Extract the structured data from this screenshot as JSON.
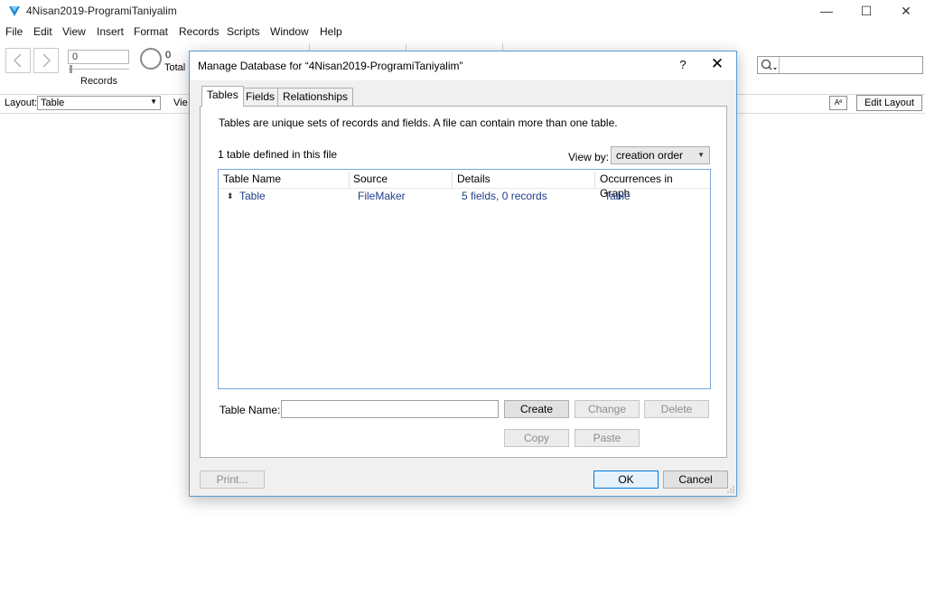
{
  "window": {
    "title": "4Nisan2019-ProgramiTaniyalim",
    "controls": {
      "minimize": "—",
      "maximize": "☐",
      "close": "✕"
    }
  },
  "menu": [
    "File",
    "Edit",
    "View",
    "Insert",
    "Format",
    "Records",
    "Scripts",
    "Window",
    "Help"
  ],
  "toolbar": {
    "record_value": "0",
    "records_label": "Records",
    "total_count": "0",
    "total_label": "Total"
  },
  "layoutbar": {
    "layout_label": "Layout:",
    "layout_value": "Table",
    "view_label": "Vie",
    "aa_label": "Aª",
    "edit_layout_label": "Edit Layout"
  },
  "dialog": {
    "title": "Manage Database for “4Nisan2019-ProgramiTaniyalim”",
    "help": "?",
    "close": "✕",
    "tabs": [
      "Tables",
      "Fields",
      "Relationships"
    ],
    "active_tab": "Tables",
    "description": "Tables are unique sets of records and fields. A file can contain more than one table.",
    "count_text": "1 table defined in this file",
    "view_by_label": "View by:",
    "view_by_value": "creation order",
    "columns": [
      "Table Name",
      "Source",
      "Details",
      "Occurrences in Graph"
    ],
    "rows": [
      {
        "name": "Table",
        "source": "FileMaker",
        "details": "5 fields, 0 records",
        "occurrences": "Table"
      }
    ],
    "table_name_label": "Table Name:",
    "table_name_value": "",
    "buttons": {
      "create": "Create",
      "change": "Change",
      "delete": "Delete",
      "copy": "Copy",
      "paste": "Paste",
      "print": "Print...",
      "ok": "OK",
      "cancel": "Cancel"
    }
  },
  "colors": {
    "dialog_border": "#5b9bd5",
    "link_text": "#1f3e8a",
    "primary_border": "#0078d7"
  }
}
